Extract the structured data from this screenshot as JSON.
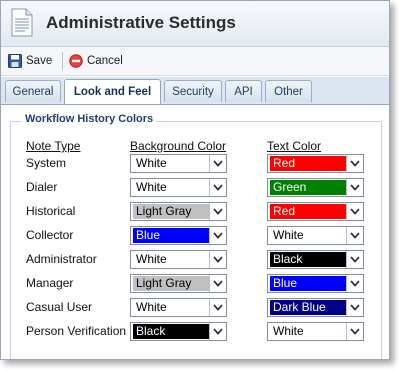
{
  "window": {
    "title": "Administrative Settings"
  },
  "toolbar": {
    "save_label": "Save",
    "cancel_label": "Cancel"
  },
  "tabs": [
    {
      "label": "General",
      "active": false
    },
    {
      "label": "Look and Feel",
      "active": true
    },
    {
      "label": "Security",
      "active": false
    },
    {
      "label": "API",
      "active": false
    },
    {
      "label": "Other",
      "active": false
    }
  ],
  "section": {
    "legend": "Workflow History Colors",
    "headers": {
      "note_type": "Note Type",
      "background": "Background Color",
      "text": "Text Color"
    }
  },
  "rows": [
    {
      "note_type": "System",
      "background": "White",
      "text": "Red"
    },
    {
      "note_type": "Dialer",
      "background": "White",
      "text": "Green"
    },
    {
      "note_type": "Historical",
      "background": "Light Gray",
      "text": "Red"
    },
    {
      "note_type": "Collector",
      "background": "Blue",
      "text": "White"
    },
    {
      "note_type": "Administrator",
      "background": "White",
      "text": "Black"
    },
    {
      "note_type": "Manager",
      "background": "Light Gray",
      "text": "Blue"
    },
    {
      "note_type": "Casual User",
      "background": "White",
      "text": "Dark Blue"
    },
    {
      "note_type": "Person Verification",
      "background": "Black",
      "text": "White"
    }
  ],
  "colors": {
    "White": {
      "bg": "#ffffff",
      "fg": "#000000"
    },
    "Red": {
      "bg": "#ff0000",
      "fg": "#ffffff"
    },
    "Green": {
      "bg": "#008000",
      "fg": "#ffffff"
    },
    "Light Gray": {
      "bg": "#c0c0c0",
      "fg": "#000000"
    },
    "Blue": {
      "bg": "#0000ff",
      "fg": "#ffffff"
    },
    "Black": {
      "bg": "#000000",
      "fg": "#ffffff"
    },
    "Dark Blue": {
      "bg": "#00008b",
      "fg": "#ffffff"
    }
  },
  "icons": {
    "title": "document-icon",
    "save": "floppy-disk-icon",
    "cancel": "no-entry-icon",
    "dropdown": "chevron-down-icon"
  }
}
